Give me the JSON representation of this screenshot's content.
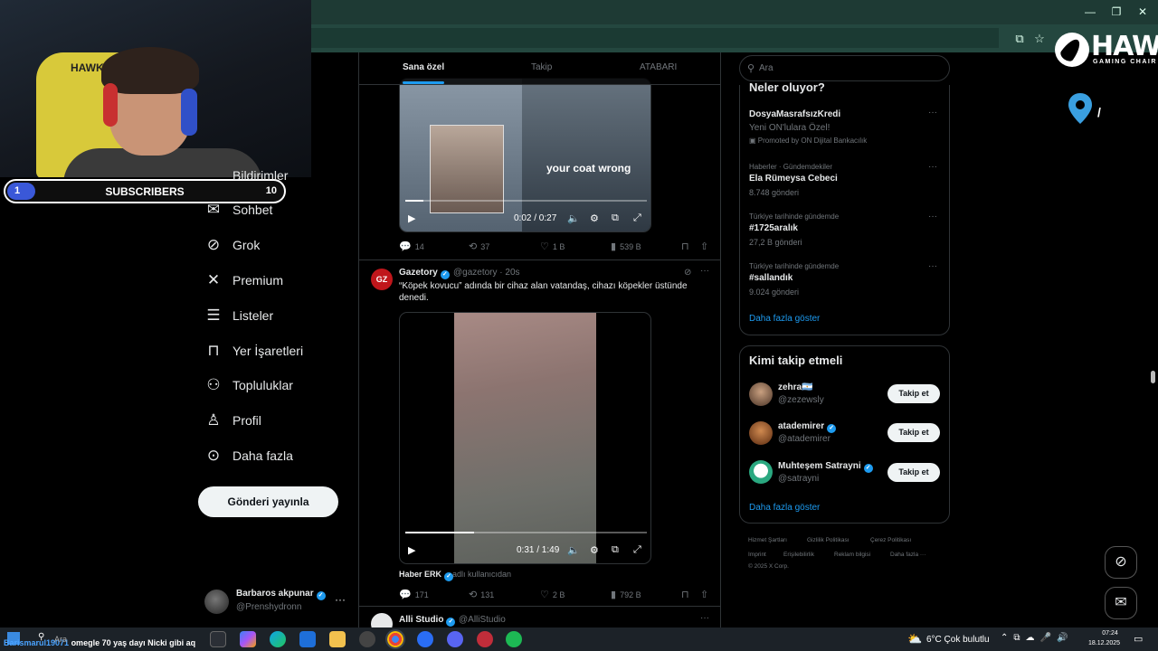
{
  "overlay": {
    "subscribers": {
      "label": "SUBSCRIBERS",
      "current": "1",
      "goal": "10",
      "progress": 0.1
    },
    "brand": {
      "name": "HAWK",
      "tagline": "GAMING CHAIR",
      "pin_letter": "/"
    }
  },
  "browser": {
    "tab_star": "☆"
  },
  "nav": {
    "hidden_item": "Bildirimler",
    "items": [
      {
        "key": "chat",
        "icon": "mail-icon",
        "label": "Sohbet"
      },
      {
        "key": "grok",
        "icon": "grok-icon",
        "label": "Grok"
      },
      {
        "key": "premium",
        "icon": "x-icon",
        "label": "Premium"
      },
      {
        "key": "lists",
        "icon": "list-icon",
        "label": "Listeler"
      },
      {
        "key": "bookmarks",
        "icon": "bookmark-icon",
        "label": "Yer İşaretleri"
      },
      {
        "key": "communities",
        "icon": "people-icon",
        "label": "Topluluklar"
      },
      {
        "key": "profile",
        "icon": "person-icon",
        "label": "Profil"
      },
      {
        "key": "more",
        "icon": "more-circle-icon",
        "label": "Daha fazla"
      }
    ],
    "post_button": "Gönderi yayınla",
    "account": {
      "name": "Barbaros akpunar",
      "handle": "@Prenshydronn",
      "more": "···"
    }
  },
  "feed": {
    "tabs": [
      "Sana özel",
      "Takip",
      "ATABARI"
    ],
    "tweet1": {
      "caption": "your coat wrong",
      "time": "0:02 / 0:27",
      "progress": 0.074,
      "replies": "14",
      "reposts": "37",
      "likes": "1 B",
      "views": "539 B"
    },
    "tweet2": {
      "name": "Gazetory",
      "handle": "@gazetory · 20s",
      "avatar_text": "GZ",
      "text": "“Köpek kovucu” adında bir cihaz alan vatandaş, cihazı köpekler üstünde denedi.",
      "time": "0:31 / 1:49",
      "progress": 0.284,
      "source": "Haber ERK",
      "source_suffix": "adlı kullanıcıdan",
      "replies": "171",
      "reposts": "131",
      "likes": "2 B",
      "views": "792 B"
    },
    "tweet3": {
      "name": "Alli Studio",
      "handle": "@AlliStudio",
      "more": "···"
    }
  },
  "sidebar": {
    "search_placeholder": "Ara",
    "trends_title": "Neler oluyor?",
    "trends": [
      {
        "category": "",
        "name": "DosyaMasrafsızKredi",
        "sub": "Yeni ON'lulara Özel!",
        "promo": "Promoted by ON Dijital Bankacılık"
      },
      {
        "category": "Haberler · Gündemdekiler",
        "name": "Ela Rümeysa Cebeci",
        "sub": "8.748 gönderi"
      },
      {
        "category": "Türkiye tarihinde gündemde",
        "name": "#1725aralık",
        "sub": "27,2 B gönderi"
      },
      {
        "category": "Türkiye tarihinde gündemde",
        "name": "#sallandık",
        "sub": "9.024 gönderi"
      }
    ],
    "trends_more": "Daha fazla göster",
    "wtf_title": "Kimi takip etmeli",
    "wtf": [
      {
        "name": "zehra🇦🇷",
        "handle": "@zezewsly",
        "button": "Takip et"
      },
      {
        "name": "atademirer",
        "handle": "@atademirer",
        "button": "Takip et"
      },
      {
        "name": "Muhteşem Satrayni",
        "handle": "@satrayni",
        "button": "Takip et"
      }
    ],
    "wtf_more": "Daha fazla göster",
    "footer": [
      "Hizmet Şartları",
      "Gizlilik Politikası",
      "Çerez Politikası",
      "Imprint",
      "Erişilebilirlik",
      "Reklam bilgisi",
      "Daha fazla ···",
      "© 2025 X Corp."
    ]
  },
  "taskbar": {
    "marquee_user": "Barismarul19071",
    "marquee_text": " omegle 70 yaş dayı Nicki gibi aq",
    "search_label": "Ara",
    "weather": "6°C  Çok bulutlu",
    "time": "07:24",
    "date": "18.12.2025"
  }
}
